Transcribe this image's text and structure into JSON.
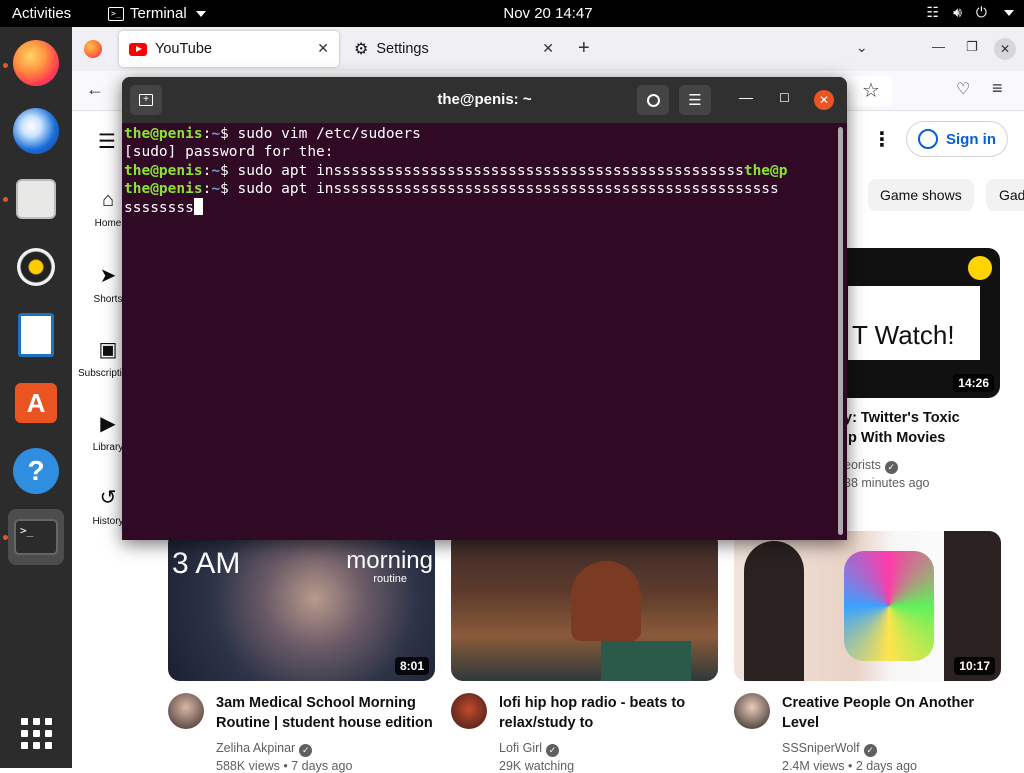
{
  "topbar": {
    "activities": "Activities",
    "app_name": "Terminal",
    "clock": "Nov 20  14:47"
  },
  "browser": {
    "tabs": [
      {
        "label": "YouTube",
        "icon": "youtube-icon",
        "selected": true
      },
      {
        "label": "Settings",
        "icon": "gear-icon",
        "selected": false
      }
    ]
  },
  "terminal": {
    "title": "the@penis: ~",
    "lines": [
      {
        "user": "the@penis",
        "path": "~",
        "symbol": "$",
        "cmd": " sudo vim /etc/sudoers"
      },
      {
        "text": "[sudo] password for the:"
      },
      {
        "user": "the@penis",
        "path": "~",
        "symbol": "$",
        "cmd": " sudo apt insssssssssssssssssssssssssssssssssssssssssssssss",
        "tail": "the@p"
      },
      {
        "user": "the@penis",
        "path": "~",
        "symbol": "$",
        "cmd": " sudo apt insssssssssssssssssssssssssssssssssssssssssssssssssss"
      },
      {
        "text": "ssssssss"
      }
    ]
  },
  "youtube": {
    "sidebar": [
      {
        "label": "Home",
        "icon": "home-icon"
      },
      {
        "label": "Shorts",
        "icon": "shorts-icon"
      },
      {
        "label": "Subscriptions",
        "icon": "subscriptions-icon"
      },
      {
        "label": "Library",
        "icon": "library-icon"
      },
      {
        "label": "History",
        "icon": "history-icon"
      }
    ],
    "sign_in": "Sign in",
    "chips": [
      "Game shows",
      "Gad"
    ],
    "top_video": {
      "thumb_text": "T Watch!",
      "duration": "14:26",
      "title_line1": "y: Twitter's Toxic",
      "title_line2": "ip With Movies",
      "channel": "eorists",
      "meta": "38 minutes ago"
    },
    "videos": [
      {
        "thumb_text_left": "3 AM",
        "thumb_text_right": "morning",
        "thumb_text_small": "routine",
        "duration": "8:01",
        "title_line1": "3am Medical School Morning",
        "title_line2": "Routine | student house edition",
        "channel": "Zeliha Akpinar",
        "meta": "588K views • 7 days ago"
      },
      {
        "duration": "",
        "title_line1": "lofi hip hop radio - beats to",
        "title_line2": "relax/study to",
        "channel": "Lofi Girl",
        "meta": "29K watching"
      },
      {
        "duration": "10:17",
        "title_line1": "Creative People On Another",
        "title_line2": "Level",
        "channel": "SSSniperWolf",
        "meta": "2.4M views • 2 days ago"
      }
    ]
  },
  "colors": {
    "terminal_bg": "#300a24",
    "prompt_user": "#8ae234",
    "prompt_path": "#729fcf",
    "ubuntu_orange": "#e95420",
    "youtube_red": "#ff0000",
    "signin_blue": "#065fd4"
  }
}
